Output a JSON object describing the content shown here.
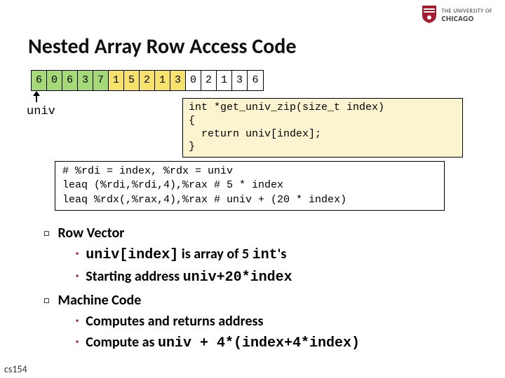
{
  "logo": {
    "line1": "THE UNIVERSITY OF",
    "line2": "CHICAGO"
  },
  "title": "Nested Array Row Access Code",
  "cells": {
    "values": [
      "6",
      "0",
      "6",
      "3",
      "7",
      "1",
      "5",
      "2",
      "1",
      "3",
      "0",
      "2",
      "1",
      "3",
      "6"
    ],
    "colors": [
      "g",
      "g",
      "g",
      "g",
      "g",
      "y",
      "y",
      "y",
      "y",
      "y",
      "w",
      "w",
      "w",
      "w",
      "w"
    ]
  },
  "univ_label": "univ",
  "code_c": "int *get_univ_zip(size_t index)\n{\n  return univ[index];\n}",
  "code_asm": "# %rdi = index, %rdx = univ\nleaq (%rdi,%rdi,4),%rax # 5 * index\nleaq %rdx(,%rax,4),%rax # univ + (20 * index)",
  "bullets": {
    "b1": "Row Vector",
    "b1_1a": "univ[index]",
    "b1_1b": " is array of 5 ",
    "b1_1c": "int",
    "b1_1d": "'s",
    "b1_2a": "Starting address ",
    "b1_2b": "univ+20*index",
    "b2": "Machine Code",
    "b2_1": "Computes and returns address",
    "b2_2a": "Compute as ",
    "b2_2b": "univ + 4*(index+4*index)"
  },
  "footer": "cs154"
}
